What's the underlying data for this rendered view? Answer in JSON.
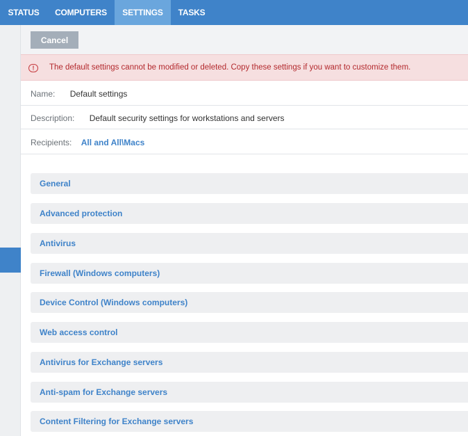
{
  "nav": {
    "tabs": [
      {
        "label": "STATUS"
      },
      {
        "label": "COMPUTERS"
      },
      {
        "label": "SETTINGS"
      },
      {
        "label": "TASKS"
      }
    ]
  },
  "toolbar": {
    "cancel_label": "Cancel"
  },
  "alert": {
    "icon": "exclamation-circle-icon",
    "text": "The default settings cannot be modified or deleted. Copy these settings if you want to customize them."
  },
  "details": {
    "name_label": "Name:",
    "name_value": "Default settings",
    "description_label": "Description:",
    "description_value": "Default security settings for workstations and servers",
    "recipients_label": "Recipients:",
    "recipients_value": "All and All\\Macs"
  },
  "sections": [
    {
      "label": "General"
    },
    {
      "label": "Advanced protection"
    },
    {
      "label": "Antivirus"
    },
    {
      "label": "Firewall (Windows computers)"
    },
    {
      "label": "Device Control (Windows computers)"
    },
    {
      "label": "Web access control"
    },
    {
      "label": "Antivirus for Exchange servers"
    },
    {
      "label": "Anti-spam for Exchange servers"
    },
    {
      "label": "Content Filtering for Exchange servers"
    }
  ],
  "colors": {
    "accent": "#3f83c9",
    "active_tab": "#6aa6dd",
    "alert_bg": "#f6dfe0",
    "alert_text": "#b3292d"
  }
}
